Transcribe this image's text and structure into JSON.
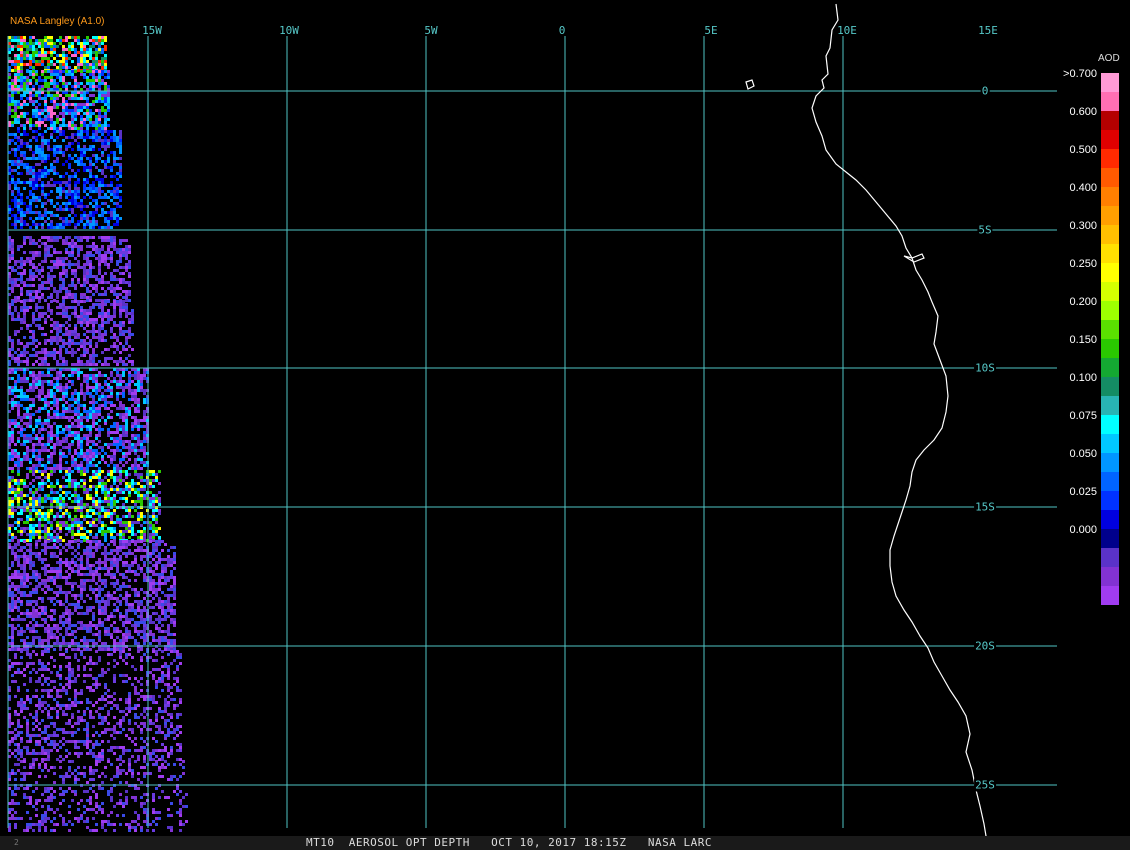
{
  "credit": "NASA Langley (A1.0)",
  "lon_labels": [
    "15W",
    "10W",
    "5W",
    "0",
    "5E",
    "10E",
    "15E"
  ],
  "lat_labels": [
    "0",
    "5S",
    "10S",
    "15S",
    "20S",
    "25S"
  ],
  "legend": {
    "title": "AOD",
    "labels": [
      ">0.700",
      "0.600",
      "0.500",
      "0.400",
      "0.300",
      "0.250",
      "0.200",
      "0.150",
      "0.100",
      "0.075",
      "0.050",
      "0.025",
      "0.000"
    ],
    "colors": [
      "#ff9ad6",
      "#ff6fb3",
      "#b40000",
      "#e00000",
      "#ff2a00",
      "#ff5a00",
      "#ff7f00",
      "#ff9f00",
      "#ffbf00",
      "#ffe000",
      "#ffff00",
      "#d4ff00",
      "#9eff00",
      "#5ae000",
      "#2ac800",
      "#14a832",
      "#148c64",
      "#28b4b4",
      "#00ffff",
      "#00c8ff",
      "#0096ff",
      "#0064ff",
      "#0032ff",
      "#0000e0",
      "#00008c",
      "#5a32c8",
      "#8232d2",
      "#a03cf0"
    ]
  },
  "footer": "MT10  AEROSOL OPT DEPTH   OCT 10, 2017 18:15Z   NASA LARC",
  "corner_mark": "2"
}
